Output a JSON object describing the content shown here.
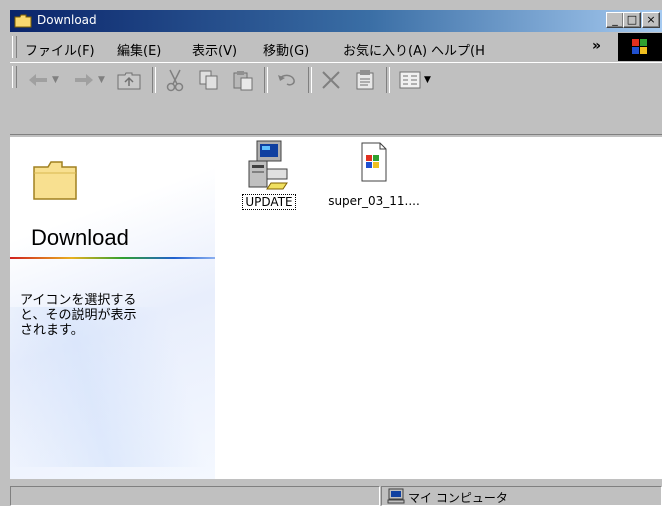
{
  "window": {
    "title": "Download",
    "buttons": {
      "minimize": "_",
      "maximize": "□",
      "close": "×"
    }
  },
  "menu": {
    "items": [
      "ファイル(F)",
      "編集(E)",
      "表示(V)",
      "移動(G)",
      "お気に入り(A)",
      "ヘルプ(H"
    ],
    "overflow": "»"
  },
  "toolbar": {
    "buttons": [
      "back-icon",
      "forward-icon",
      "up-folder-icon",
      "cut-icon",
      "copy-icon",
      "paste-icon",
      "undo-icon",
      "delete-icon",
      "properties-icon",
      "views-icon"
    ]
  },
  "webview": {
    "title": "Download",
    "description": "アイコンを選択する\nと、その説明が表示\nされます。"
  },
  "files": [
    {
      "name": "UPDATE",
      "icon": "setup-computer-icon",
      "selected": true
    },
    {
      "name": "super_03_11....",
      "icon": "media-file-icon",
      "selected": false
    }
  ],
  "status": {
    "zone": "マイ コンピュータ"
  }
}
